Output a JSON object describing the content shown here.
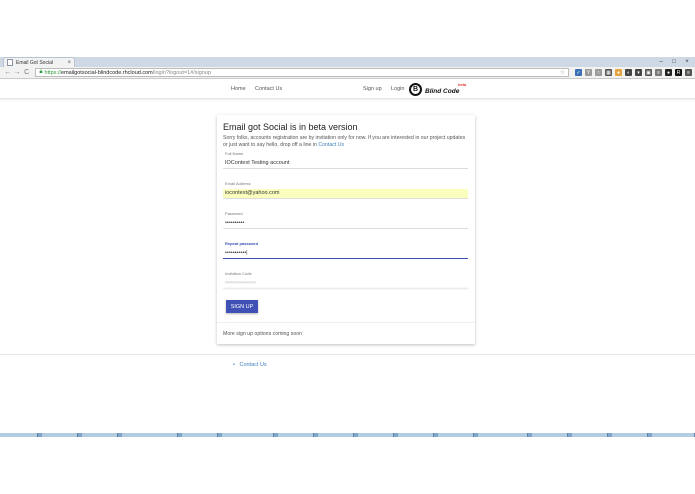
{
  "browser": {
    "tab_title": "Email Got Social",
    "tab_close": "×",
    "window_controls": [
      "–",
      "□",
      "×"
    ],
    "nav": {
      "back": "←",
      "forward": "→",
      "reload": "C"
    },
    "url": {
      "scheme": "https://",
      "host": "emailgotsocial-blindcode.rhcloud.com",
      "path": "/login?logout=1#/signup"
    },
    "extension_icons": [
      {
        "name": "cast-ext-icon",
        "color": "#3b6fb6",
        "glyph": "✓"
      },
      {
        "name": "filter-ext-icon",
        "color": "#999999",
        "glyph": "Y"
      },
      {
        "name": "star-ext-icon",
        "color": "#999999",
        "glyph": "☆"
      },
      {
        "name": "apps-grid-icon",
        "color": "#555555",
        "glyph": "▦"
      },
      {
        "name": "cookie-ext-icon",
        "color": "#e6a23c",
        "glyph": "●"
      },
      {
        "name": "moon-ext-icon",
        "color": "#444444",
        "glyph": "◐"
      },
      {
        "name": "pocket-ext-icon",
        "color": "#444444",
        "glyph": "▾"
      },
      {
        "name": "dashboard-ext-icon",
        "color": "#555555",
        "glyph": "▣"
      },
      {
        "name": "readability-ext-icon",
        "color": "#777777",
        "glyph": "≡"
      },
      {
        "name": "circle-ext-icon",
        "color": "#222222",
        "glyph": "●"
      },
      {
        "name": "r-ext-icon",
        "color": "#111111",
        "glyph": "R"
      },
      {
        "name": "menu-icon",
        "color": "#555555",
        "glyph": "≡"
      }
    ]
  },
  "site_nav": {
    "home": "Home",
    "contact": "Contact Us",
    "signup": "Sign up",
    "login": "Login",
    "logo_text": "Blind Code",
    "logo_mark": "B",
    "logo_beta": "beta"
  },
  "card": {
    "title": "Email got Social is in beta version",
    "intro": "Sorry folks, accounts registration are by invitation only for now. If you are interested in our project updates or just want to say hello, drop off a line in",
    "intro_link": "Contact Us",
    "fields": {
      "full_name": {
        "label": "Full Name",
        "value": "IOContext Testing account"
      },
      "email": {
        "label": "Email Address",
        "value": "iocontext@yahoo.com"
      },
      "password": {
        "label": "Password",
        "value": "••••••••••"
      },
      "repeat_password": {
        "label": "Repeat password",
        "value": "•••••••••••|"
      },
      "invitation_code": {
        "label": "Invitation Code",
        "value": "••••••••••••••••"
      }
    },
    "signup_button": "SIGN UP",
    "footer_note": "More sign up options coming soon"
  },
  "footer": {
    "bullet": "•",
    "contact": "Contact Us"
  },
  "colors": {
    "accent": "#3f51b5",
    "link": "#3f7fbf",
    "autofill": "#faffbd"
  }
}
